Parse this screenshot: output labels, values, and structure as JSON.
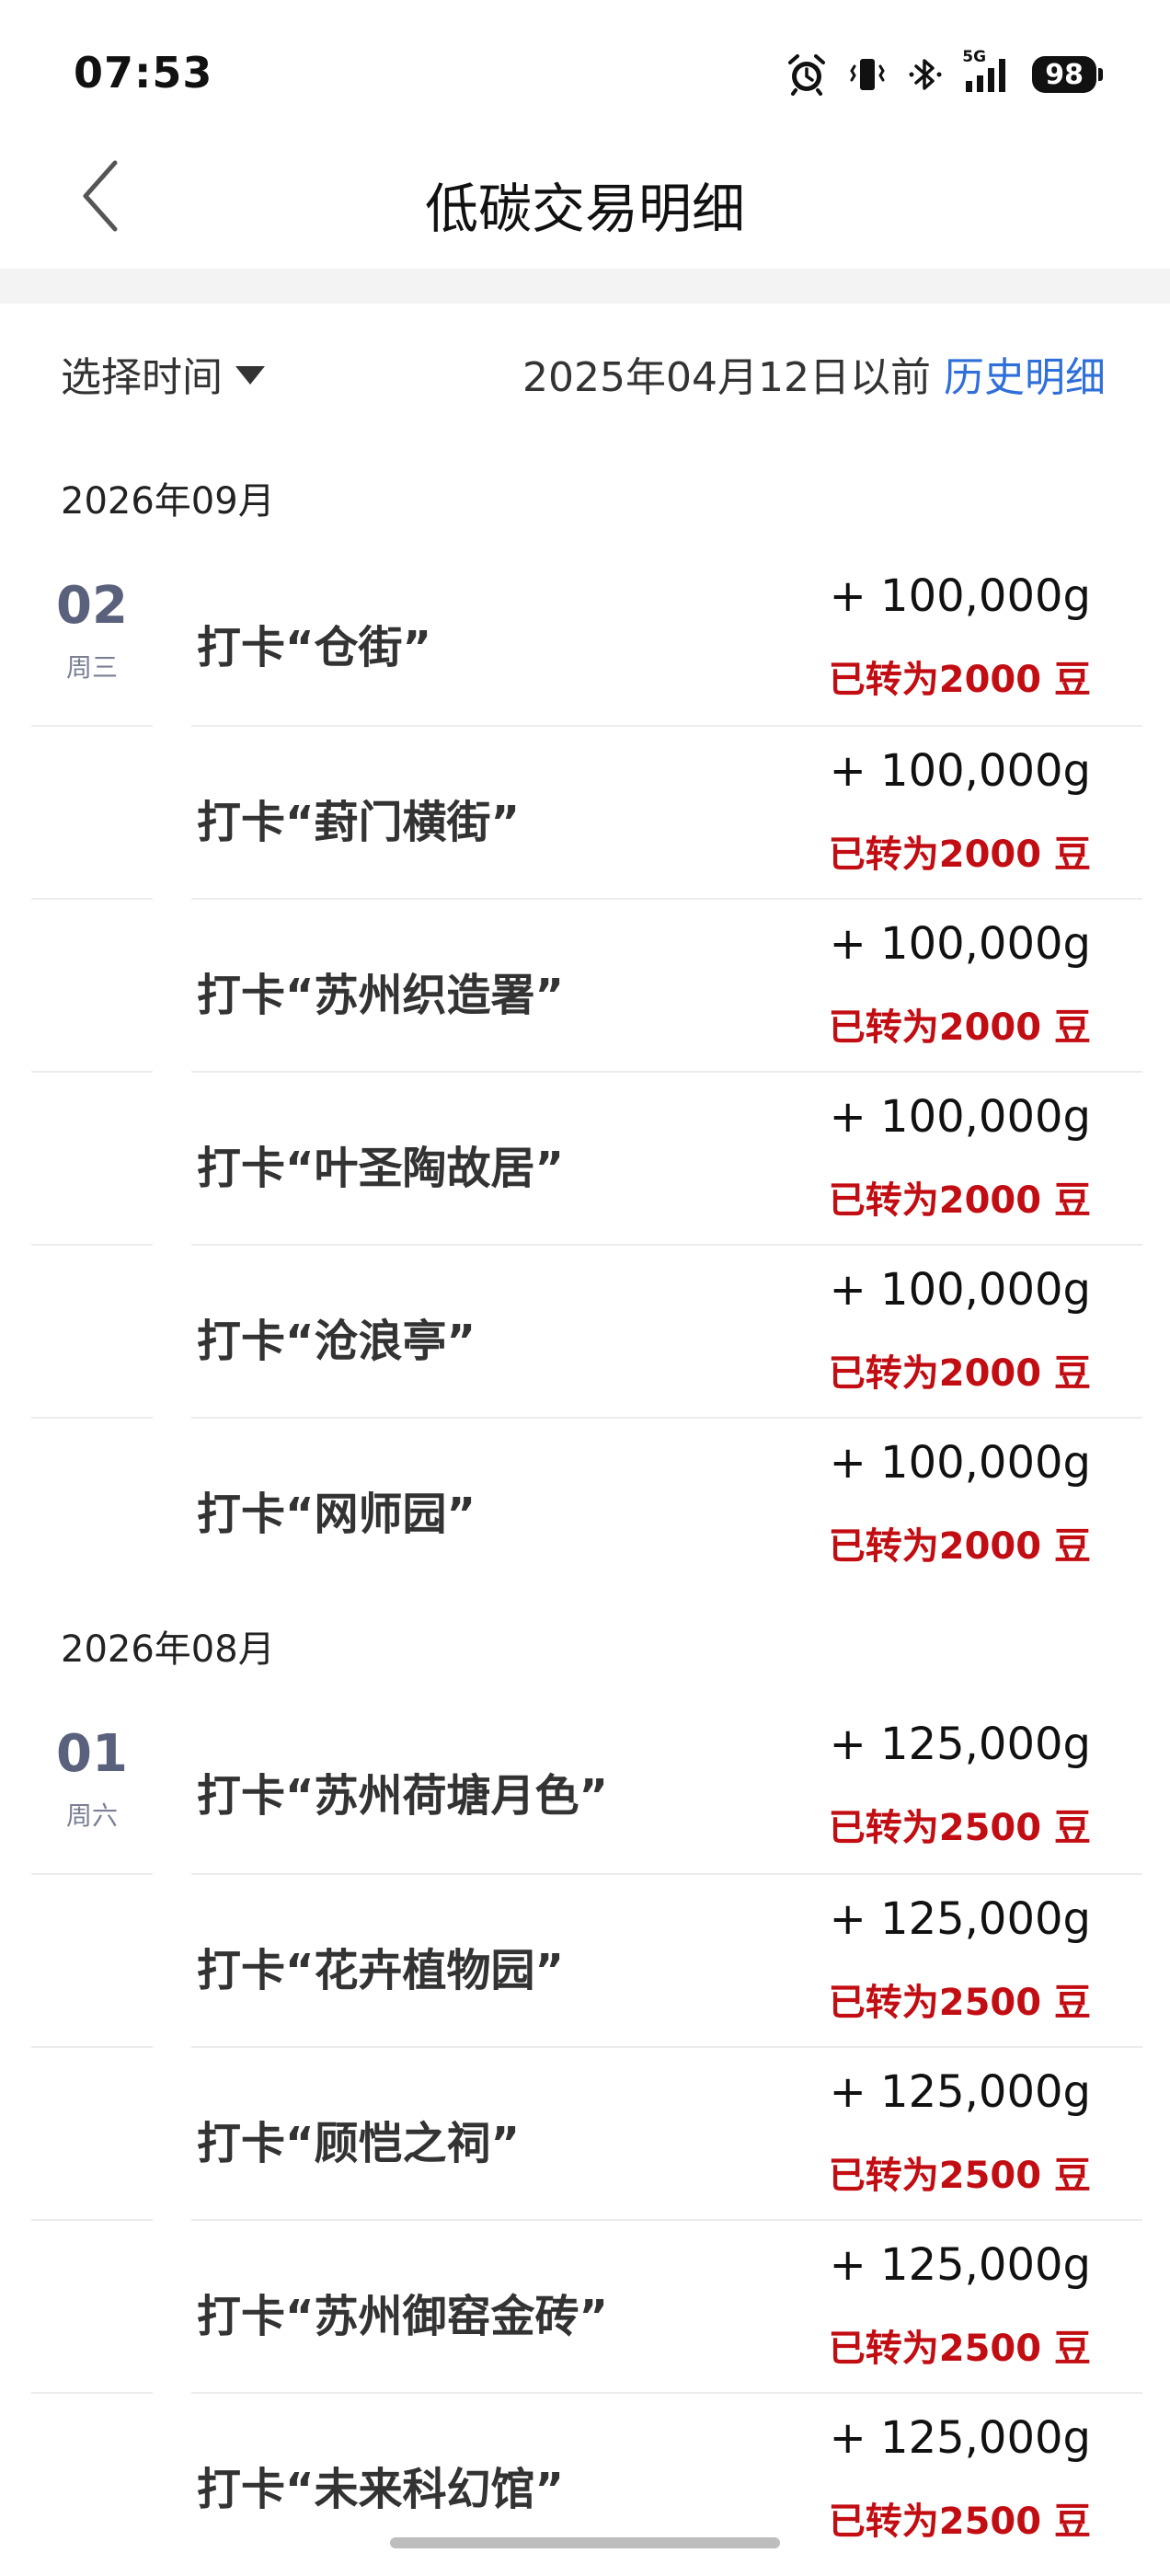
{
  "status_bar": {
    "time": "07:53",
    "network": "5G",
    "battery": "98"
  },
  "nav": {
    "title": "低碳交易明细"
  },
  "filter": {
    "time_label": "选择时间",
    "cutoff_text": "2025年04月12日以前",
    "history_link": "历史明细"
  },
  "colors": {
    "accent_link": "#2f6fd9",
    "converted_red": "#c20d13",
    "date_number": "#5a617c"
  },
  "groups": [
    {
      "month": "2026年09月",
      "entries": [
        {
          "day": "02",
          "weekday": "周三",
          "title": "打卡“仓街”",
          "amount": "+ 100,000g",
          "converted": "已转为2000 豆"
        },
        {
          "title": "打卡“葑门横街”",
          "amount": "+ 100,000g",
          "converted": "已转为2000 豆"
        },
        {
          "title": "打卡“苏州织造署”",
          "amount": "+ 100,000g",
          "converted": "已转为2000 豆"
        },
        {
          "title": "打卡“叶圣陶故居”",
          "amount": "+ 100,000g",
          "converted": "已转为2000 豆"
        },
        {
          "title": "打卡“沧浪亭”",
          "amount": "+ 100,000g",
          "converted": "已转为2000 豆"
        },
        {
          "title": "打卡“网师园”",
          "amount": "+ 100,000g",
          "converted": "已转为2000 豆"
        }
      ]
    },
    {
      "month": "2026年08月",
      "entries": [
        {
          "day": "01",
          "weekday": "周六",
          "title": "打卡“苏州荷塘月色”",
          "amount": "+ 125,000g",
          "converted": "已转为2500 豆"
        },
        {
          "title": "打卡“花卉植物园”",
          "amount": "+ 125,000g",
          "converted": "已转为2500 豆"
        },
        {
          "title": "打卡“顾恺之祠”",
          "amount": "+ 125,000g",
          "converted": "已转为2500 豆"
        },
        {
          "title": "打卡“苏州御窑金砖”",
          "amount": "+ 125,000g",
          "converted": "已转为2500 豆"
        },
        {
          "title": "打卡“未来科幻馆”",
          "amount": "+ 125,000g",
          "converted": "已转为2500 豆"
        }
      ]
    }
  ]
}
